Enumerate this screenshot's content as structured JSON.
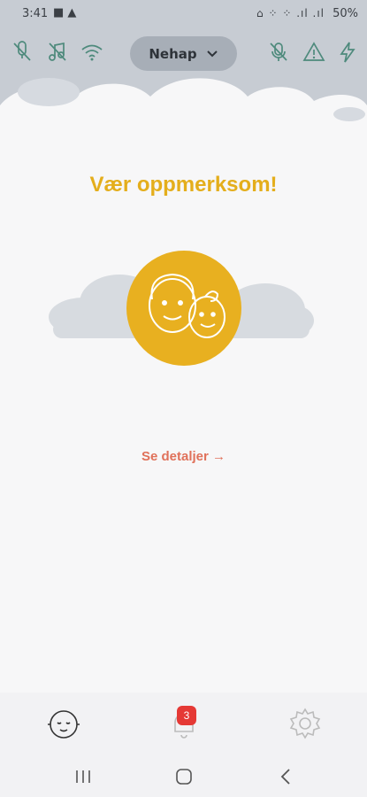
{
  "status_bar": {
    "time": "3:41",
    "battery": "50%"
  },
  "top_bar": {
    "selector_label": "Nehap"
  },
  "main": {
    "title": "Vær oppmerksom!",
    "details_link": "Se detaljer →"
  },
  "bottom_nav": {
    "notifications_badge": "3"
  },
  "colors": {
    "accent": "#e4ae1c",
    "link": "#e0715a",
    "sky": "#c7ccd3",
    "badge": "#e53935"
  },
  "icons": [
    "microphone-off-icon",
    "music-note-off-icon",
    "wifi-icon",
    "chevron-down-icon",
    "mic-off-icon",
    "warning-icon",
    "lightning-icon",
    "baby-face-icon",
    "bell-icon",
    "gear-icon"
  ]
}
